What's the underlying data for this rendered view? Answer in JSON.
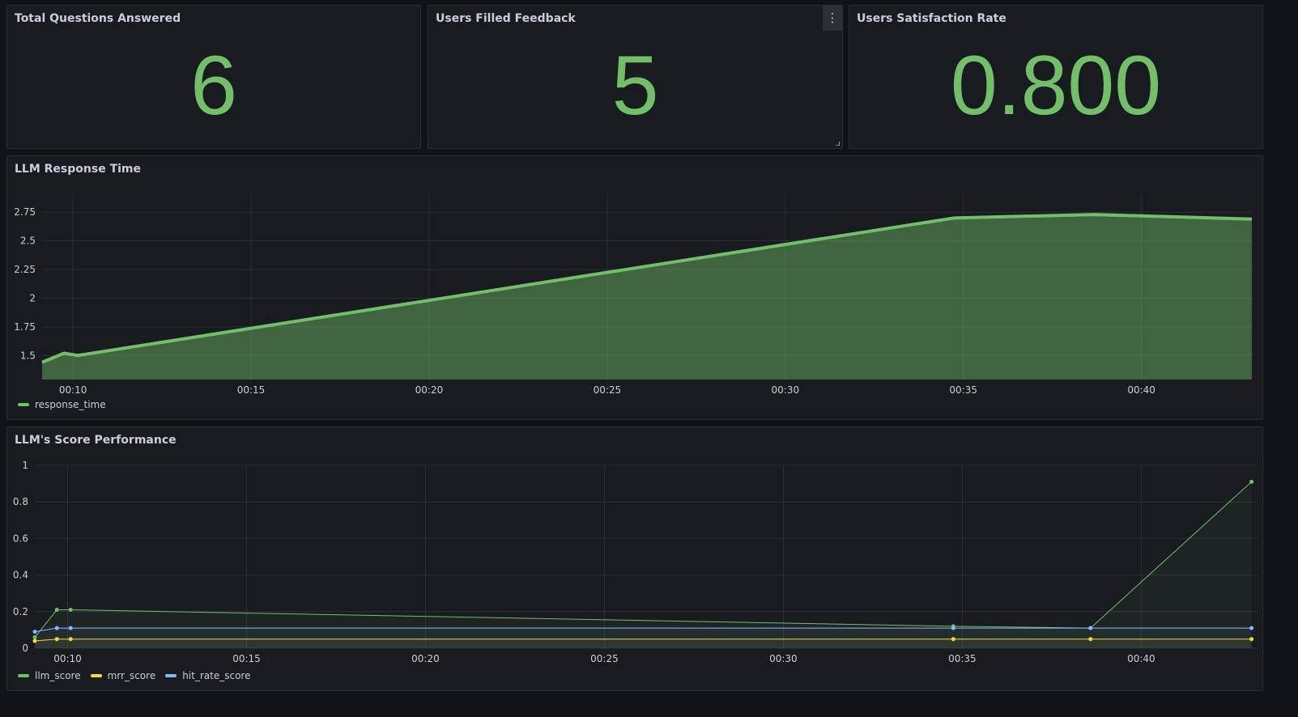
{
  "colors": {
    "green": "#73bf69",
    "yellow": "#fade2a",
    "blue": "#8ab8ff"
  },
  "stats": [
    {
      "title": "Total Questions Answered",
      "value": "6"
    },
    {
      "title": "Users Filled Feedback",
      "value": "5",
      "menu_icon": "kebab-menu-icon"
    },
    {
      "title": "Users Satisfaction Rate",
      "value": "0.800"
    }
  ],
  "charts": {
    "response": {
      "title": "LLM Response Time",
      "legend": [
        "response_time"
      ]
    },
    "score": {
      "title": "LLM's Score Performance",
      "legend": [
        "llm_score",
        "mrr_score",
        "hit_rate_score"
      ]
    }
  },
  "chart_data": [
    {
      "type": "area",
      "title": "LLM Response Time",
      "x_ticks": [
        "00:10",
        "00:15",
        "00:20",
        "00:25",
        "00:30",
        "00:35",
        "00:40"
      ],
      "y_ticks": [
        "1.5",
        "1.75",
        "2",
        "2.25",
        "2.5",
        "2.75"
      ],
      "xlim": [
        "00:09:08",
        "00:43:06"
      ],
      "ylim": [
        1.29,
        2.9
      ],
      "series": [
        {
          "name": "response_time",
          "color": "#73bf69",
          "x": [
            "00:09:08",
            "00:09:45",
            "00:10:08",
            "00:34:45",
            "00:38:40",
            "00:43:06"
          ],
          "y": [
            1.44,
            1.52,
            1.5,
            2.7,
            2.73,
            2.69
          ]
        }
      ]
    },
    {
      "type": "line",
      "title": "LLM's Score Performance",
      "x_ticks": [
        "00:10",
        "00:15",
        "00:20",
        "00:25",
        "00:30",
        "00:35",
        "00:40"
      ],
      "y_ticks": [
        "0",
        "0.2",
        "0.4",
        "0.6",
        "0.8",
        "1"
      ],
      "xlim": [
        "00:09:05",
        "00:43:15"
      ],
      "ylim": [
        0,
        1
      ],
      "series": [
        {
          "name": "llm_score",
          "color": "#73bf69",
          "x": [
            "00:09:05",
            "00:09:42",
            "00:10:05",
            "00:34:45",
            "00:38:35",
            "00:43:05"
          ],
          "y": [
            0.06,
            0.21,
            0.21,
            0.12,
            0.11,
            0.91
          ]
        },
        {
          "name": "mrr_score",
          "color": "#fade2a",
          "x": [
            "00:09:05",
            "00:09:42",
            "00:10:05",
            "00:34:45",
            "00:38:35",
            "00:43:05"
          ],
          "y": [
            0.04,
            0.05,
            0.05,
            0.05,
            0.05,
            0.05
          ]
        },
        {
          "name": "hit_rate_score",
          "color": "#8ab8ff",
          "x": [
            "00:09:05",
            "00:09:42",
            "00:10:05",
            "00:34:45",
            "00:38:35",
            "00:43:05"
          ],
          "y": [
            0.09,
            0.11,
            0.11,
            0.11,
            0.11,
            0.11
          ]
        }
      ]
    }
  ]
}
